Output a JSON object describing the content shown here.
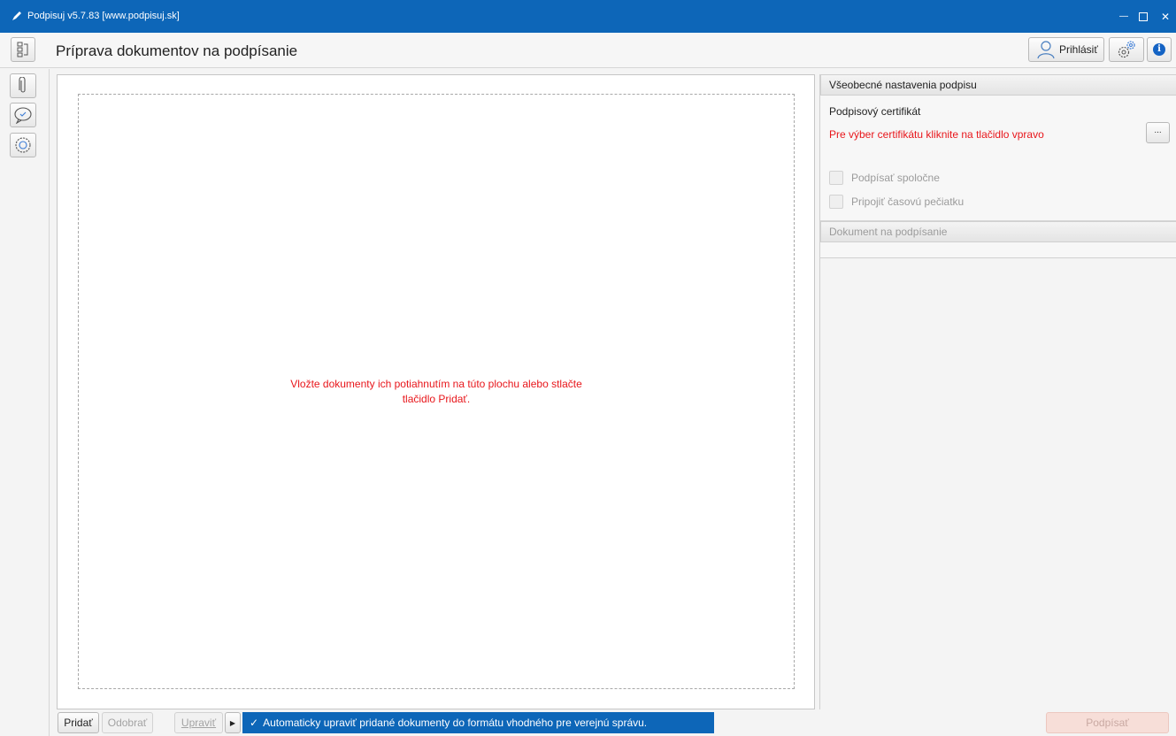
{
  "window": {
    "title": "Podpisuj v5.7.83 [www.podpisuj.sk]",
    "minimize_glyph": "—",
    "close_glyph": "✕"
  },
  "header": {
    "page_title": "Príprava dokumentov na podpísanie",
    "login_label": "Prihlásiť",
    "info_glyph": "i"
  },
  "main": {
    "drop_message": "Vložte dokumenty ich potiahnutím na túto plochu alebo stlačte tlačidlo Pridať."
  },
  "settings_panel": {
    "section_title": "Všeobecné nastavenia podpisu",
    "certificate_label": "Podpisový certifikát",
    "certificate_hint": "Pre výber certifikátu kliknite na tlačidlo vpravo",
    "browse_label": "...",
    "checkboxes": [
      {
        "label": "Podpísať spoločne",
        "checked": false,
        "enabled": false
      },
      {
        "label": "Pripojiť časovú pečiatku",
        "checked": false,
        "enabled": false
      }
    ],
    "document_section_title": "Dokument na podpísanie"
  },
  "bottombar": {
    "add_label": "Pridať",
    "remove_label": "Odobrať",
    "edit_label": "Upraviť",
    "play_glyph": "▶",
    "check_glyph": "✓",
    "auto_edit_text": "Automaticky upraviť pridané dokumenty do formátu vhodného pre verejnú správu.",
    "sign_label": "Podpísať"
  },
  "colors": {
    "titlebar": "#0d66b8",
    "warning_text": "#e8161b",
    "info_icon": "#1463c4",
    "sign_button_disabled": "#f7ded8"
  },
  "icons": [
    "app-pen-icon",
    "document-tree-icon",
    "user-icon",
    "gears-icon",
    "info-icon",
    "paperclip-icon",
    "speech-check-icon",
    "badge-gear-icon"
  ]
}
